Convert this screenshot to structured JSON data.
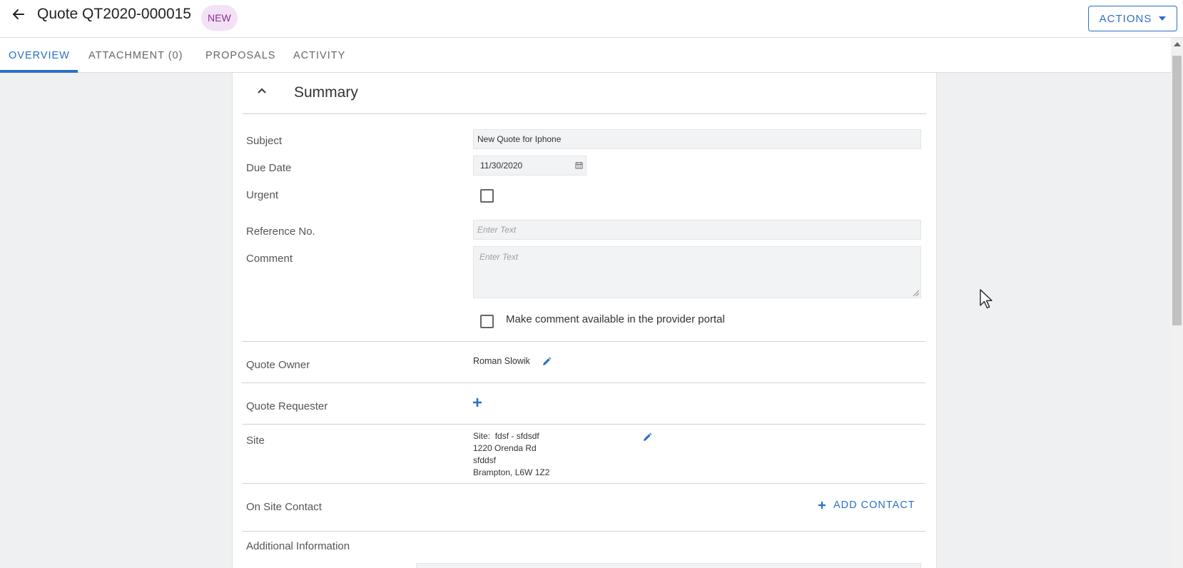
{
  "header": {
    "title": "Quote QT2020-000015",
    "status_badge": "NEW",
    "actions_label": "ACTIONS"
  },
  "tabs": [
    {
      "label": "OVERVIEW",
      "active": true
    },
    {
      "label": "ATTACHMENT (0)",
      "active": false
    },
    {
      "label": "PROPOSALS",
      "active": false
    },
    {
      "label": "ACTIVITY",
      "active": false
    }
  ],
  "summary": {
    "title": "Summary",
    "subject_label": "Subject",
    "subject_value": "New Quote for Iphone",
    "due_date_label": "Due Date",
    "due_date_value": "11/30/2020",
    "urgent_label": "Urgent",
    "urgent_checked": false,
    "reference_label": "Reference No.",
    "reference_placeholder": "Enter Text",
    "comment_label": "Comment",
    "comment_placeholder": "Enter Text",
    "portal_checkbox_label": "Make comment available in the provider portal",
    "portal_checked": false,
    "quote_owner_label": "Quote Owner",
    "quote_owner_value": "Roman Slowik",
    "quote_requester_label": "Quote Requester",
    "site_label": "Site",
    "site": {
      "prefix": "Site:",
      "name": "fdsf - sfdsdf",
      "address_line1": "1220 Orenda Rd",
      "address_line2": "sfddsf",
      "address_line3": "Brampton, L6W 1Z2"
    },
    "on_site_contact_label": "On Site Contact",
    "add_contact_label": "ADD CONTACT",
    "additional_info_label": "Additional Information"
  },
  "colors": {
    "accent": "#2a6fc9",
    "badge_bg": "#f3e1f5",
    "badge_text": "#8a2c94",
    "page_bg": "#eef0f2"
  },
  "icons": {
    "back": "arrow-left-icon",
    "actions_caret": "caret-down-icon",
    "collapse": "chevron-up-icon",
    "calendar": "calendar-icon",
    "edit": "pencil-icon",
    "add": "plus-icon"
  }
}
